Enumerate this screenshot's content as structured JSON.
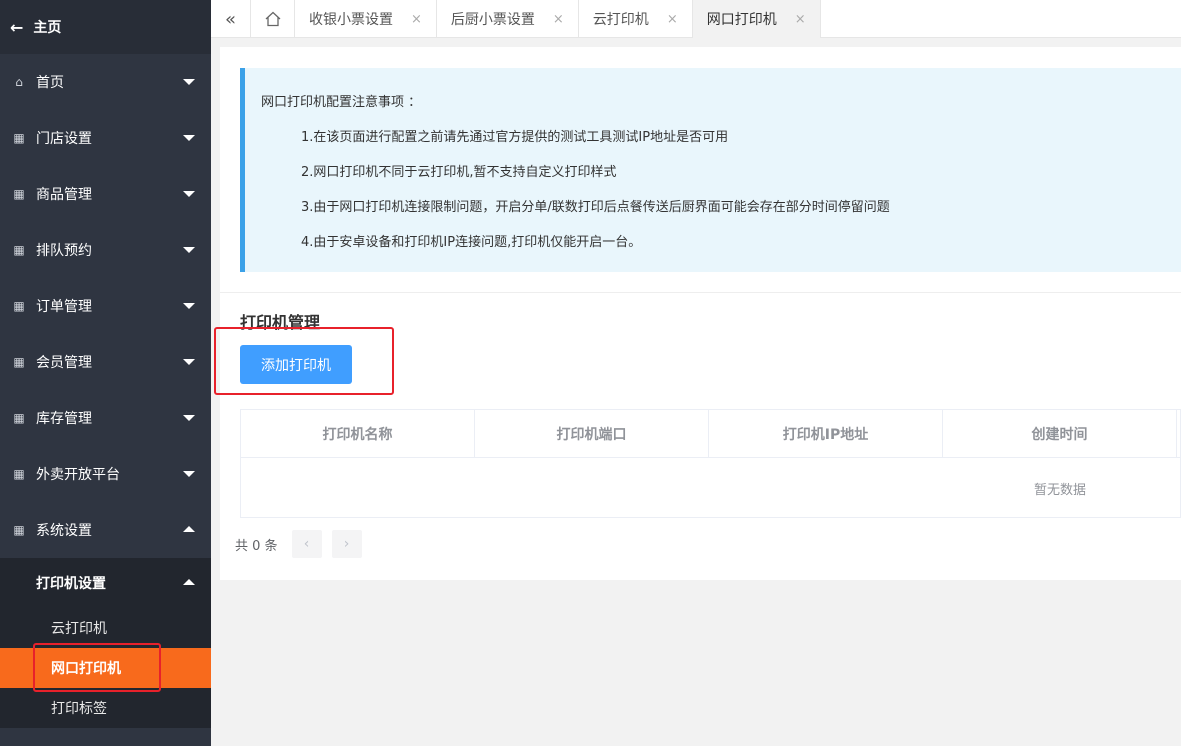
{
  "sidebar": {
    "home_label": "主页",
    "items": [
      {
        "label": "首页",
        "expanded": false
      },
      {
        "label": "门店设置",
        "expanded": false
      },
      {
        "label": "商品管理",
        "expanded": false
      },
      {
        "label": "排队预约",
        "expanded": false
      },
      {
        "label": "订单管理",
        "expanded": false
      },
      {
        "label": "会员管理",
        "expanded": false
      },
      {
        "label": "库存管理",
        "expanded": false
      },
      {
        "label": "外卖开放平台",
        "expanded": false
      },
      {
        "label": "系统设置",
        "expanded": true
      }
    ],
    "sub_group": {
      "label": "打印机设置",
      "items": [
        {
          "label": "云打印机",
          "active": false
        },
        {
          "label": "网口打印机",
          "active": true
        },
        {
          "label": "打印标签",
          "active": false
        }
      ]
    }
  },
  "tabs": [
    {
      "label": "收银小票设置",
      "active": false
    },
    {
      "label": "后厨小票设置",
      "active": false
    },
    {
      "label": "云打印机",
      "active": false
    },
    {
      "label": "网口打印机",
      "active": true
    }
  ],
  "tab_close_glyph": "×",
  "notice": {
    "title": "网口打印机配置注意事项 ：",
    "lines": [
      "1.在该页面进行配置之前请先通过官方提供的测试工具测试IP地址是否可用",
      "2.网口打印机不同于云打印机,暂不支持自定义打印样式",
      "3.由于网口打印机连接限制问题，开启分单/联数打印后点餐传送后厨界面可能会存在部分时间停留问题",
      "4.由于安卓设备和打印机IP连接问题,打印机仅能开启一台。"
    ]
  },
  "section_title": "打印机管理",
  "add_button_label": "添加打印机",
  "table": {
    "columns": [
      "打印机名称",
      "打印机端口",
      "打印机IP地址",
      "创建时间"
    ],
    "empty_text": "暂无数据"
  },
  "pager": {
    "total_text": "共 0 条"
  },
  "colors": {
    "sidebar_bg": "#2f3541",
    "active_leaf": "#f86a1c",
    "primary_button": "#409eff",
    "notice_border": "#3ba1e8",
    "highlight_box": "#e8212b"
  }
}
